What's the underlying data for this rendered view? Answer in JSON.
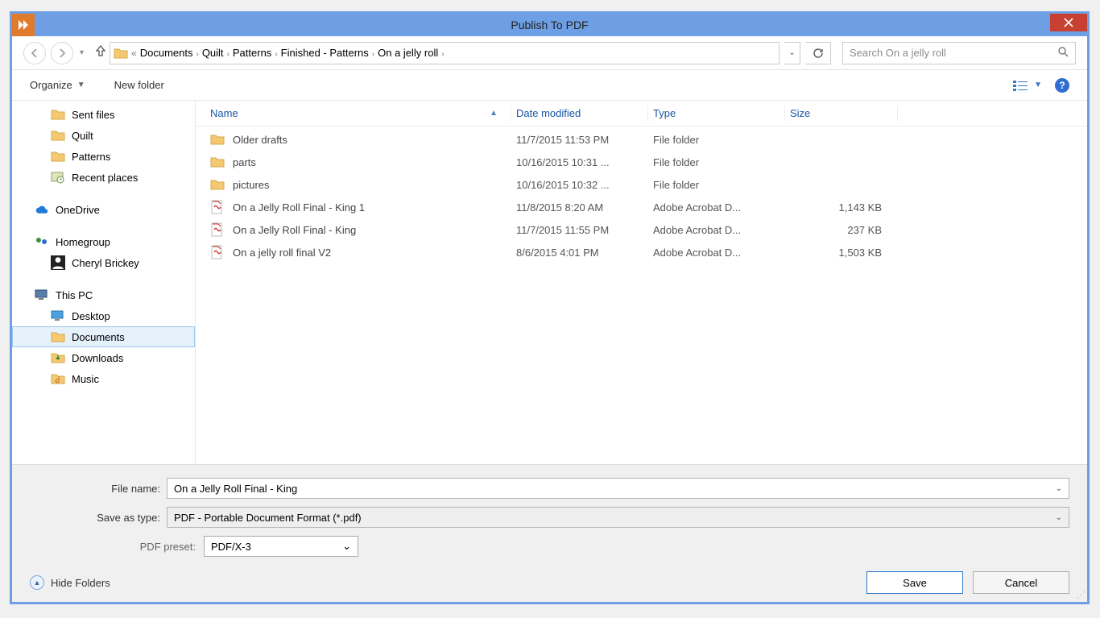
{
  "title": "Publish To PDF",
  "breadcrumb": [
    "Documents",
    "Quilt",
    "Patterns",
    "Finished - Patterns",
    "On a jelly roll"
  ],
  "search": {
    "placeholder": "Search On a jelly roll"
  },
  "toolbar": {
    "organize": "Organize",
    "newfolder": "New folder"
  },
  "sidebar": {
    "quick": [
      "Sent files",
      "Quilt",
      "Patterns",
      "Recent places"
    ],
    "onedrive": "OneDrive",
    "homegroup": "Homegroup",
    "user": "Cheryl Brickey",
    "thispc": "This PC",
    "pc_items": [
      "Desktop",
      "Documents",
      "Downloads",
      "Music"
    ]
  },
  "columns": {
    "name": "Name",
    "date": "Date modified",
    "type": "Type",
    "size": "Size"
  },
  "files": [
    {
      "icon": "folder",
      "name": "Older drafts",
      "date": "11/7/2015 11:53 PM",
      "type": "File folder",
      "size": ""
    },
    {
      "icon": "folder",
      "name": "parts",
      "date": "10/16/2015 10:31 ...",
      "type": "File folder",
      "size": ""
    },
    {
      "icon": "folder",
      "name": "pictures",
      "date": "10/16/2015 10:32 ...",
      "type": "File folder",
      "size": ""
    },
    {
      "icon": "pdf",
      "name": "On a Jelly Roll Final - King 1",
      "date": "11/8/2015 8:20 AM",
      "type": "Adobe Acrobat D...",
      "size": "1,143 KB"
    },
    {
      "icon": "pdf",
      "name": "On a Jelly Roll Final - King",
      "date": "11/7/2015 11:55 PM",
      "type": "Adobe Acrobat D...",
      "size": "237 KB"
    },
    {
      "icon": "pdf",
      "name": "On a jelly roll final V2",
      "date": "8/6/2015 4:01 PM",
      "type": "Adobe Acrobat D...",
      "size": "1,503 KB"
    }
  ],
  "form": {
    "filename_label": "File name:",
    "filename_value": "On a Jelly Roll Final - King",
    "saveastype_label": "Save as type:",
    "saveastype_value": "PDF - Portable Document Format (*.pdf)",
    "preset_label": "PDF preset:",
    "preset_value": "PDF/X-3"
  },
  "footer": {
    "hide_folders": "Hide Folders",
    "save": "Save",
    "cancel": "Cancel"
  }
}
